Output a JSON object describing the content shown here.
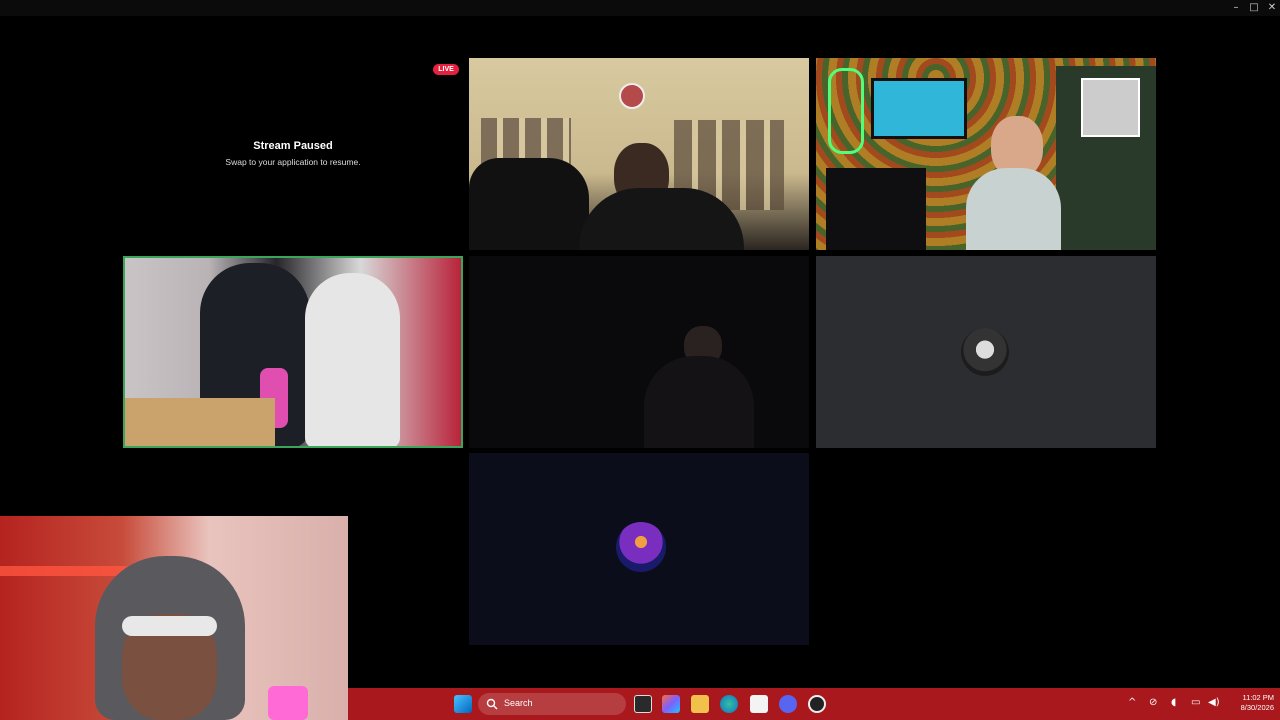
{
  "window": {
    "minimize_icon": "–",
    "maximize_icon": "□",
    "close_icon": "✕"
  },
  "stream_paused": {
    "badge": "LIVE",
    "title": "Stream Paused",
    "subtitle": "Swap to your application to resume."
  },
  "participants": [
    {
      "tile": "top-middle",
      "type": "video"
    },
    {
      "tile": "top-right",
      "type": "video",
      "accent": "#e8b020"
    },
    {
      "tile": "middle-left",
      "type": "video",
      "speaking": true,
      "speaking_color": "#3ba55c"
    },
    {
      "tile": "middle-center",
      "type": "video"
    },
    {
      "tile": "middle-right",
      "type": "avatar"
    },
    {
      "tile": "bottom-center",
      "type": "avatar"
    }
  ],
  "taskbar": {
    "search_placeholder": "Search",
    "time": "11:02 PM",
    "date": "8/30/2026",
    "icons": [
      "windows-start-icon",
      "search-icon",
      "task-view-icon",
      "copilot-icon",
      "file-explorer-icon",
      "edge-icon",
      "microsoft-store-icon",
      "discord-icon",
      "obs-icon",
      "tray-chevron-icon",
      "network-icon",
      "microphone-icon",
      "battery-icon",
      "volume-icon"
    ],
    "bg_color": "#a8181c"
  }
}
